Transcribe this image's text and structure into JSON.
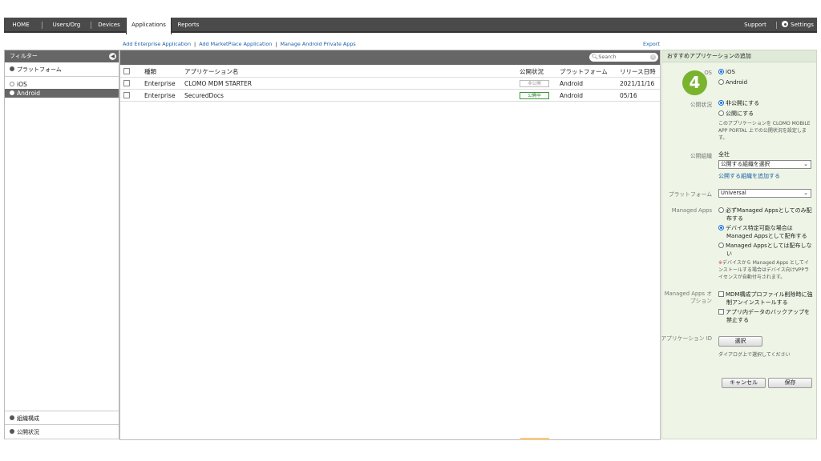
{
  "nav": {
    "items": [
      {
        "label": "HOME"
      },
      {
        "label": "Users/Org"
      },
      {
        "label": "Devices"
      },
      {
        "label": "Applications"
      },
      {
        "label": "Reports"
      }
    ],
    "support": "Support",
    "settings": "Settings"
  },
  "actions": {
    "add_enterprise": "Add Enterprise Application",
    "add_marketplace": "Add MarketPlace Application",
    "manage_android": "Manage Android Private Apps",
    "sep": "|",
    "export": "Export"
  },
  "filter": {
    "title": "フィルター",
    "platform_section": "プラットフォーム",
    "options": [
      "iOS",
      "Android"
    ],
    "selected": "Android",
    "org_section": "組織構成",
    "status_section": "公開状況"
  },
  "table": {
    "search_placeholder": "Search",
    "columns": [
      "種類",
      "アプリケーション名",
      "公開状況",
      "プラットフォーム",
      "リリース日時"
    ],
    "rows": [
      {
        "type": "Enterprise",
        "name": "CLOMO MDM STARTER",
        "status": "非公開",
        "platform": "Android",
        "date": "2021/11/16"
      },
      {
        "type": "Enterprise",
        "name": "SecuredDocs",
        "status": "公開中",
        "platform": "Android",
        "date": "05/16"
      }
    ]
  },
  "panel": {
    "title": "おすすめアプリケーションの追加",
    "os_label": "OS",
    "os_options": [
      "iOS",
      "Android"
    ],
    "publish_label": "公開状況",
    "publish_options": [
      "非公開にする",
      "公開にする"
    ],
    "publish_note": "このアプリケーションを CLOMO MOBILE APP PORTAL 上での公開状況を設定します。",
    "org_label": "公開組織",
    "org_value": "全社",
    "org_select": "公開する組織を選択",
    "org_add_link": "公開する組織を追加する",
    "platform_label": "プラットフォーム",
    "platform_value": "Universal",
    "managed_label": "Managed Apps",
    "managed_options": [
      "必ずManaged Appsとしてのみ配布する",
      "デバイス特定可能な場合は Managed Appsとして配布する",
      "Managed Appsとしては配布しない"
    ],
    "managed_note_mark": "※",
    "managed_note": "デバイスから Managed Apps としてインストールする場合はデバイス向けVPPライセンスが自動付与されます。",
    "managed_opt_label": "Managed Apps オプション",
    "managed_opt_items": [
      "MDM構成プロファイル削除時に強制アンインストールする",
      "アプリ内データのバックアップを禁止する"
    ],
    "appid_label": "アプリケーション ID",
    "select_button": "選択",
    "appid_note": "ダイアログ上で選択してください",
    "cancel_button": "キャンセル",
    "save_button": "保存"
  },
  "step_number": "4"
}
